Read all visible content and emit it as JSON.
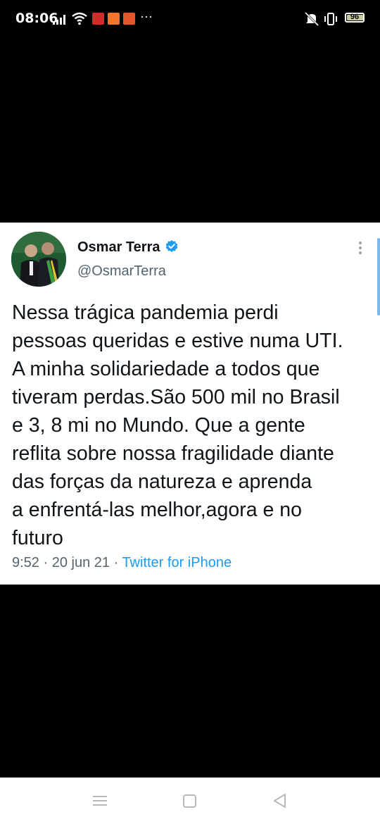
{
  "status_bar": {
    "time": "08:06",
    "battery": "96"
  },
  "tweet": {
    "display_name": "Osmar Terra",
    "handle": "@OsmarTerra",
    "text_lines": [
      "Nessa trágica pandemia perdi",
      "pessoas queridas e estive numa UTI.",
      "A minha solidariedade a todos que",
      "tiveram perdas.São 500 mil no Brasil",
      "e 3, 8 mi no Mundo. Que a gente",
      "reflita sobre nossa fragilidade diante",
      "das forças da natureza e aprenda",
      "a enfrentá-las melhor,agora e no",
      "futuro"
    ],
    "time": "9:52",
    "separator": " · ",
    "date": "20 jun 21",
    "source": "Twitter for iPhone"
  },
  "icons": {
    "verified": "verified-badge-icon",
    "more": "more-vertical-icon",
    "nav_menu": "menu-icon",
    "nav_home": "home-icon",
    "nav_back": "back-icon"
  },
  "colors": {
    "accent": "#1d9bf0",
    "text": "#0f1419",
    "secondary": "#536471"
  }
}
